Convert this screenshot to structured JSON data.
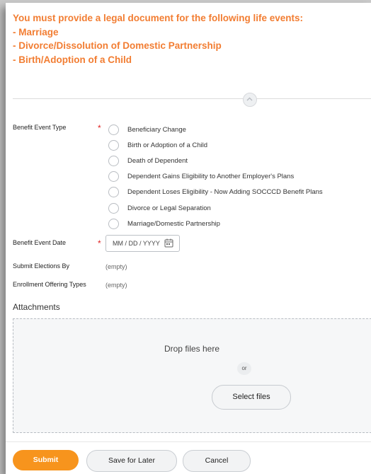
{
  "notice": {
    "heading": "You must provide a legal document for the following life events:",
    "items": [
      "- Marriage",
      "- Divorce/Dissolution of Domestic Partnership",
      "- Birth/Adoption of a Child"
    ]
  },
  "form": {
    "benefit_event_type": {
      "label": "Benefit Event Type",
      "required_mark": "*",
      "options": [
        "Beneficiary Change",
        "Birth or Adoption of a Child",
        "Death of Dependent",
        "Dependent Gains Eligibility to Another Employer's Plans",
        "Dependent Loses Eligibility - Now Adding SOCCCD Benefit Plans",
        "Divorce or Legal Separation",
        "Marriage/Domestic Partnership"
      ]
    },
    "benefit_event_date": {
      "label": "Benefit Event Date",
      "required_mark": "*",
      "placeholder": "MM / DD / YYYY"
    },
    "submit_elections_by": {
      "label": "Submit Elections By",
      "value": "(empty)"
    },
    "enrollment_offering_types": {
      "label": "Enrollment Offering Types",
      "value": "(empty)"
    }
  },
  "attachments": {
    "title": "Attachments",
    "drop_text": "Drop files here",
    "or_text": "or",
    "select_label": "Select files"
  },
  "footer": {
    "submit_label": "Submit",
    "save_label": "Save for Later",
    "cancel_label": "Cancel"
  },
  "colors": {
    "accent": "#f7941d",
    "notice_text": "#f27d32",
    "required": "#e02222"
  },
  "icons": {
    "collapse": "chevron-up-icon",
    "date": "calendar-icon"
  }
}
